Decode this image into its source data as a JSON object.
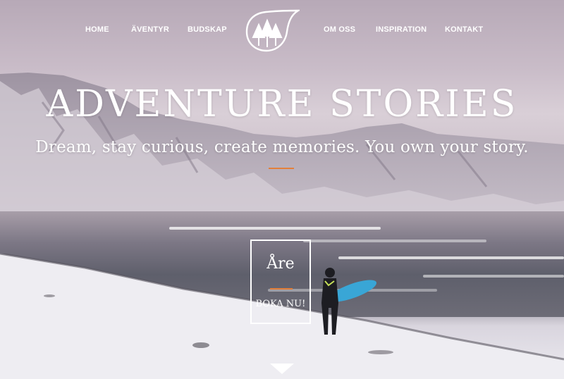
{
  "nav": {
    "left": [
      "HOME",
      "ÄVENTYR",
      "BUDSKAP"
    ],
    "right": [
      "OM OSS",
      "INSPIRATION",
      "KONTAKT"
    ]
  },
  "hero": {
    "title": "ADVENTURE STORIES",
    "subtitle": "Dream, stay curious, create memories. You own your story."
  },
  "cta": {
    "title": "Åre",
    "link": "BOKA NU!"
  },
  "colors": {
    "accent": "#e37f3a",
    "text": "#ffffff",
    "board": "#39a6d6"
  },
  "icons": {
    "logo": "forest-leaf-logo-icon",
    "scroll": "down-arrow-icon"
  }
}
